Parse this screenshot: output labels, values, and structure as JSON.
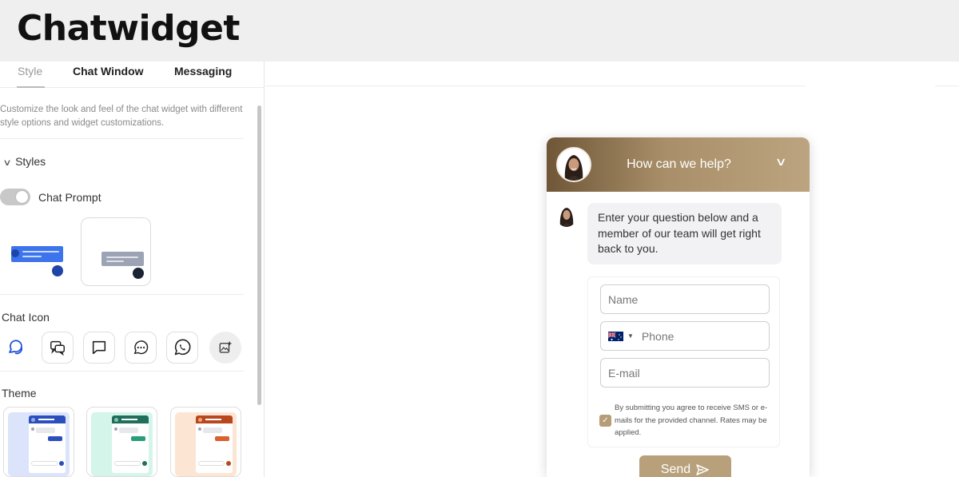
{
  "app": {
    "title": "Chatwidget"
  },
  "tabs": [
    {
      "label": "Style",
      "active": true
    },
    {
      "label": "Chat Window",
      "active": false
    },
    {
      "label": "Messaging",
      "active": false
    }
  ],
  "style_panel": {
    "description": "Customize the look and feel of the chat widget with different style options and widget customizations.",
    "styles_section": {
      "label": "Styles",
      "expanded": true
    },
    "chat_prompt": {
      "label": "Chat Prompt",
      "enabled": true
    },
    "chat_icon": {
      "label": "Chat Icon",
      "icons": [
        "chat-bubbles-icon",
        "chat-double-icon",
        "chat-bubble-icon",
        "chat-dots-icon",
        "whatsapp-icon",
        "upload-image-icon"
      ]
    },
    "theme": {
      "label": "Theme",
      "options": [
        {
          "accent": "#2c4fbe",
          "background": "#dbe4fb"
        },
        {
          "accent": "#1f6f5a",
          "background": "#d4f5ea"
        },
        {
          "accent": "#b8471e",
          "background": "#fde5d4"
        }
      ]
    }
  },
  "widget": {
    "header_title": "How can we help?",
    "welcome_message": "Enter your question below and a member of our team will get right back to you.",
    "form": {
      "name_placeholder": "Name",
      "phone_placeholder": "Phone",
      "email_placeholder": "E-mail",
      "consent_text": "By submitting you agree to receive SMS or e-mails for the provided channel. Rates may be applied.",
      "consent_checked": true
    },
    "send_label": "Send",
    "colors": {
      "header_start": "#6e5637",
      "header_end": "#bba47f",
      "button": "#b8a07a"
    }
  }
}
